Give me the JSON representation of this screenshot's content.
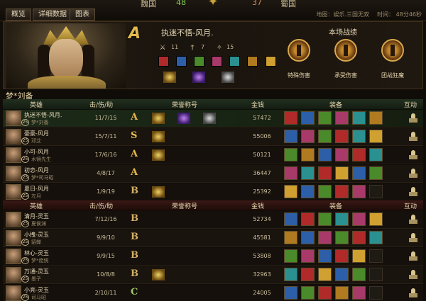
{
  "tabs": [
    "概览",
    "详细数据",
    "图表"
  ],
  "score": {
    "left_label": "魏国",
    "left_value": "48",
    "right_value": "37",
    "right_label": "蜀国"
  },
  "map_info": "地图：娱乐.三国无双",
  "time_info": "时间： 48分46秒",
  "header": {
    "grade": "A",
    "player": "执迷不悟-风月.",
    "kills": "11",
    "deaths": "7",
    "assists": "15",
    "performance_title": "本场战绩",
    "medals": [
      "特殊伤害",
      "承受伤害",
      "团战狂魔"
    ]
  },
  "team1": {
    "label": "梦*刘备",
    "columns": {
      "hero": "英雄",
      "kda": "击/伤/助",
      "title": "荣誉称号",
      "gold": "金钱",
      "equip": "装备",
      "interact": "互动"
    },
    "rows": [
      {
        "name": "执迷不悟-风月.",
        "hero": "梦*刘备",
        "level": "25",
        "kda": "11/7/15",
        "grade": "A",
        "gold": "57472",
        "titles": 3
      },
      {
        "name": "豪豪-风月",
        "hero": "邓艾",
        "level": "25",
        "kda": "15/7/11",
        "grade": "S",
        "gold": "55006",
        "titles": 1
      },
      {
        "name": "小可-风月",
        "hero": "水镜先生",
        "level": "25",
        "kda": "17/6/16",
        "grade": "A",
        "gold": "50121",
        "titles": 1
      },
      {
        "name": "初恋-风月",
        "hero": "梦*司马昭",
        "level": "25",
        "kda": "4/8/17",
        "grade": "A",
        "gold": "36447",
        "titles": 0
      },
      {
        "name": "夏日-风月",
        "hero": "左月",
        "level": "25",
        "kda": "1/9/19",
        "grade": "B",
        "gold": "25392",
        "titles": 1
      }
    ]
  },
  "team2": {
    "columns": {
      "hero": "英雄",
      "kda": "击/伤/助",
      "title": "荣誉称号",
      "gold": "金钱",
      "equip": "装备",
      "interact": "互动"
    },
    "rows": [
      {
        "name": "清月-灵玉",
        "hero": "夏侯渊",
        "level": "25",
        "kda": "7/12/16",
        "grade": "B",
        "gold": "52734",
        "titles": 0
      },
      {
        "name": "小拽-灵玉",
        "hero": "貂蝉",
        "level": "25",
        "kda": "9/9/10",
        "grade": "B",
        "gold": "45581",
        "titles": 0
      },
      {
        "name": "林心-灵玉",
        "hero": "梦*庞统",
        "level": "25",
        "kda": "9/9/15",
        "grade": "B",
        "gold": "53808",
        "titles": 0
      },
      {
        "name": "万通-灵玉",
        "hero": "墨子",
        "level": "25",
        "kda": "10/8/8",
        "grade": "B",
        "gold": "32963",
        "titles": 1
      },
      {
        "name": "小亮-灵玉",
        "hero": "司马昭",
        "level": "25",
        "kda": "2/10/11",
        "grade": "C",
        "gold": "24005",
        "titles": 0
      }
    ]
  },
  "colors": {
    "grade_A": "#e4b84a",
    "grade_S": "#f0c050",
    "grade_B": "#d4b064",
    "grade_C": "#9ec86a"
  }
}
